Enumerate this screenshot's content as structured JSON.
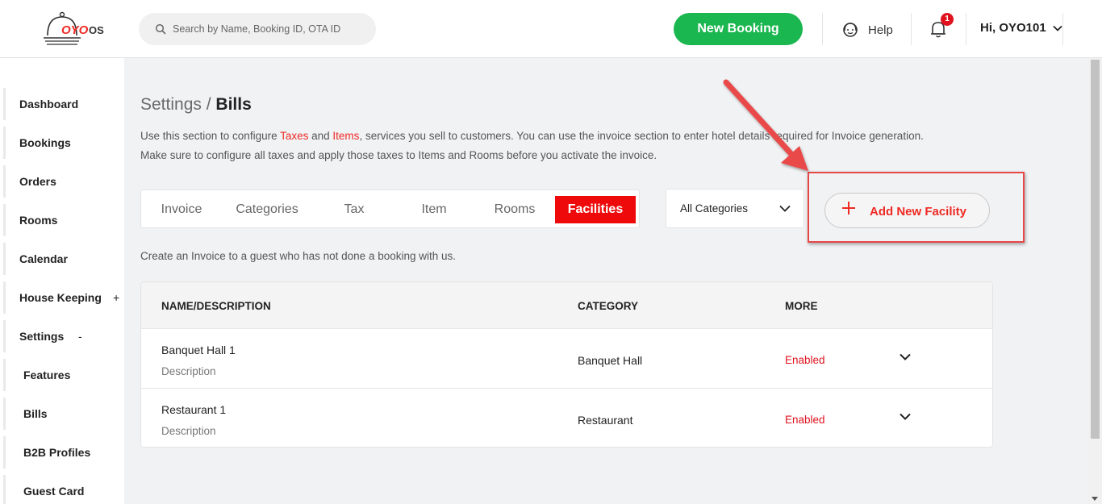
{
  "header": {
    "logo_text": "OYO",
    "logo_suffix": "OS",
    "search_placeholder": "Search by Name, Booking ID, OTA ID",
    "new_booking_label": "New Booking",
    "help_label": "Help",
    "notification_count": "1",
    "user_greeting": "Hi, OYO101"
  },
  "sidebar": {
    "items": [
      {
        "label": "Dashboard"
      },
      {
        "label": "Bookings"
      },
      {
        "label": "Orders"
      },
      {
        "label": "Rooms"
      },
      {
        "label": "Calendar"
      },
      {
        "label": "House Keeping",
        "toggle": "+"
      },
      {
        "label": "Settings",
        "toggle": "-"
      },
      {
        "label": "Features"
      },
      {
        "label": "Bills"
      },
      {
        "label": "B2B Profiles"
      },
      {
        "label": "Guest Card"
      }
    ]
  },
  "main": {
    "breadcrumb_parent": "Settings /",
    "breadcrumb_current": "Bills",
    "intro_part1": "Use this section to configure ",
    "intro_taxes": "Taxes",
    "intro_and": " and ",
    "intro_items": "Items",
    "intro_part2": ", services you sell to customers. You can use the invoice section to enter hotel details required for Invoice generation. Make sure to configure all taxes and apply those taxes to Items and Rooms before you activate the invoice.",
    "tabs": [
      {
        "label": "Invoice"
      },
      {
        "label": "Categories"
      },
      {
        "label": "Tax"
      },
      {
        "label": "Item"
      },
      {
        "label": "Rooms"
      },
      {
        "label": "Facilities",
        "active": true
      }
    ],
    "category_filter": "All Categories",
    "add_button_label": "Add New Facility",
    "note": "Create an Invoice to a guest who has not done a booking with us.",
    "table": {
      "columns": [
        "NAME/DESCRIPTION",
        "CATEGORY",
        "MORE"
      ],
      "rows": [
        {
          "name": "Banquet Hall 1",
          "description": "Description",
          "category": "Banquet Hall",
          "status": "Enabled"
        },
        {
          "name": "Restaurant 1",
          "description": "Description",
          "category": "Restaurant",
          "status": "Enabled"
        }
      ]
    }
  },
  "colors": {
    "brand_red": "#ee2a24",
    "new_booking_green": "#1ab64f",
    "active_tab": "#ee0a0a",
    "annotation_red": "#e94848"
  },
  "icons": [
    "search-icon",
    "help-headset-icon",
    "bell-icon",
    "chevron-down-icon",
    "plus-icon",
    "annotation-arrow"
  ]
}
